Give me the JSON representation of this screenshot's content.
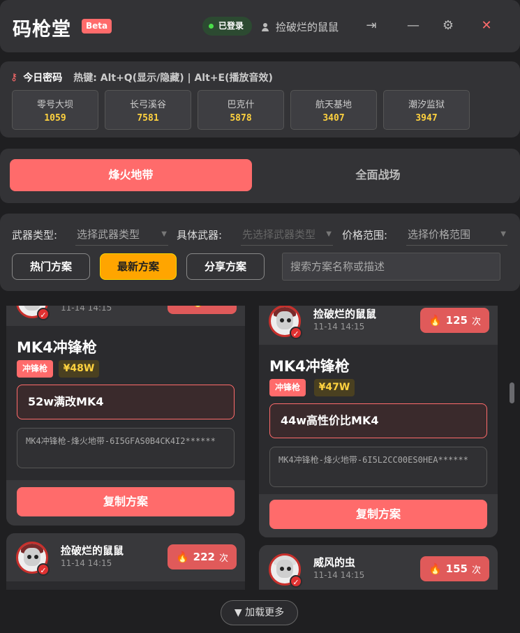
{
  "header": {
    "app_title": "码枪堂",
    "beta": "Beta",
    "login_status": "已登录",
    "username": "捡破烂的鼠鼠",
    "icons": [
      "logout-icon",
      "minimize-icon",
      "gear-icon",
      "close-icon"
    ],
    "logout_glyph": "⇥",
    "minimize_glyph": "—",
    "settings_glyph": "⚙",
    "close_glyph": "✕"
  },
  "password": {
    "title": "今日密码",
    "hotkey": "热键: Alt+Q(显示/隐藏) | Alt+E(播放音效)",
    "codes": [
      {
        "name": "零号大坝",
        "value": "1059"
      },
      {
        "name": "长弓溪谷",
        "value": "7581"
      },
      {
        "name": "巴克什",
        "value": "5878"
      },
      {
        "name": "航天基地",
        "value": "3407"
      },
      {
        "name": "潮汐监狱",
        "value": "3947"
      }
    ]
  },
  "modes": {
    "active": "烽火地带",
    "inactive": "全面战场"
  },
  "filters": {
    "weapon_type_label": "武器类型:",
    "weapon_type_value": "选择武器类型",
    "weapon_label": "具体武器:",
    "weapon_value": "先选择武器类型",
    "price_label": "价格范围:",
    "price_value": "选择价格范围",
    "sort": [
      "热门方案",
      "最新方案",
      "分享方案"
    ],
    "active_sort": "最新方案",
    "search_placeholder": "搜索方案名称或描述"
  },
  "cards": [
    {
      "author": "",
      "date": "11-14 14:15",
      "count": "",
      "unit": "",
      "weapon": "MK4冲锋枪",
      "type_tag": "冲锋枪",
      "price": "¥48W",
      "plan_title": "52w满改MK4",
      "code": "MK4冲锋枪-烽火地带-6I5GFAS0B4CK4I2******",
      "copy": "复制方案"
    },
    {
      "author": "捡破烂的鼠鼠",
      "date": "11-14 14:15",
      "count": "125",
      "unit": "次",
      "weapon": "MK4冲锋枪",
      "type_tag": "冲锋枪",
      "price": "¥47W",
      "plan_title": "44w高性价比MK4",
      "code": "MK4冲锋枪-烽火地带-6I5L2CC00ES0HEA******",
      "copy": "复制方案"
    },
    {
      "author": "捡破烂的鼠鼠",
      "date": "11-14 14:15",
      "count": "222",
      "unit": "次"
    },
    {
      "author": "威风的虫",
      "date": "11-14 14:15",
      "count": "155",
      "unit": "次"
    }
  ],
  "load_more": "▼ 加载更多",
  "colors": {
    "accent": "#ff6b6b",
    "gold": "#ffd23f",
    "active_sort": "#ffa500"
  }
}
